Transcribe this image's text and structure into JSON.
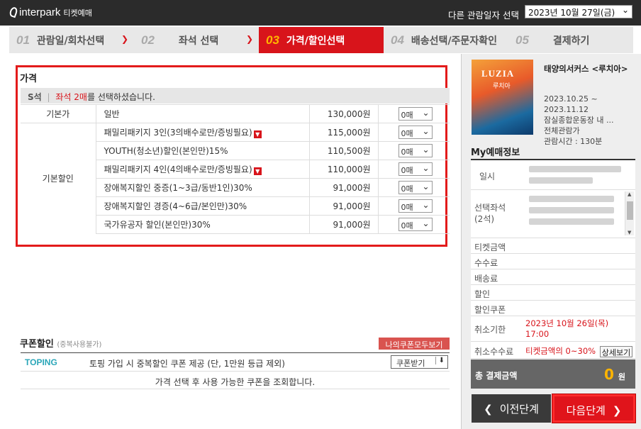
{
  "header": {
    "logo_text": "interpark",
    "logo_sub": "티켓예매",
    "other_date_label": "다른 관람일자 선택",
    "selected_date": "2023년 10월 27일(금)"
  },
  "steps": [
    {
      "num": "01",
      "label": "관람일/회차선택"
    },
    {
      "num": "02",
      "label": "좌석 선택"
    },
    {
      "num": "03",
      "label": "가격/할인선택"
    },
    {
      "num": "04",
      "label": "배송선택/주문자확인"
    },
    {
      "num": "05",
      "label": "결제하기"
    }
  ],
  "price": {
    "title": "가격",
    "seat_grade": "S석",
    "seat_msg_prefix": "좌석 2매",
    "seat_msg_suffix": "를 선택하셨습니다.",
    "base_category": "기본가",
    "discount_category": "기본할인",
    "rows": [
      {
        "name": "일반",
        "price": "130,000원",
        "qty": "0매",
        "mark": false
      },
      {
        "name": "패밀리패키지 3인(3의배수로만/증빙필요)",
        "price": "115,000원",
        "qty": "0매",
        "mark": true
      },
      {
        "name": "YOUTH(청소년)할인(본인만)15%",
        "price": "110,500원",
        "qty": "0매",
        "mark": false
      },
      {
        "name": "패밀리패키지 4인(4의배수로만/증빙필요)",
        "price": "110,000원",
        "qty": "0매",
        "mark": true
      },
      {
        "name": "장애복지할인 중증(1~3급/동반1인)30%",
        "price": "91,000원",
        "qty": "0매",
        "mark": false
      },
      {
        "name": "장애복지할인 경증(4~6급/본인만)30%",
        "price": "91,000원",
        "qty": "0매",
        "mark": false
      },
      {
        "name": "국가유공자 할인(본인만)30%",
        "price": "91,000원",
        "qty": "0매",
        "mark": false
      }
    ]
  },
  "coupon": {
    "title": "쿠폰할인",
    "title_note": "(중복사용불가)",
    "my_coupon_button": "나의쿠폰모두보기",
    "toping_logo": "TOPING",
    "toping_text": "토핑 가입 시 중복할인 쿠폰 제공 (단, 1만원 등급 제외)",
    "receive_button": "쿠폰받기",
    "note": "가격 선택 후 사용 가능한 쿠폰을 조회합니다."
  },
  "show": {
    "poster_title": "LUZIA",
    "poster_sub": "루치아",
    "title": "태양의서커스 <루치아>",
    "period_start": "2023.10.25 ~",
    "period_end": "2023.11.12",
    "venue": "잠실종합운동장 내 ...",
    "rating": "전체관람가",
    "runtime": "관람시간 : 130분"
  },
  "myinfo": {
    "title": "My예매정보",
    "date_label": "일시",
    "seat_label": "선택좌석",
    "seat_count": "(2석)",
    "ticket_label": "티켓금액",
    "fee_label": "수수료",
    "delivery_label": "배송료",
    "discount_label": "할인",
    "coupon_label": "할인쿠폰",
    "cancel_deadline_label": "취소기한",
    "cancel_deadline_value": "2023년 10월 26일(목) 17:00",
    "cancel_fee_label": "취소수수료",
    "cancel_fee_value": "티켓금액의 0~30%",
    "detail_button": "상세보기",
    "total_label": "총 결제금액",
    "total_amount": "0",
    "total_unit": "원"
  },
  "nav": {
    "prev": "이전단계",
    "next": "다음단계"
  }
}
